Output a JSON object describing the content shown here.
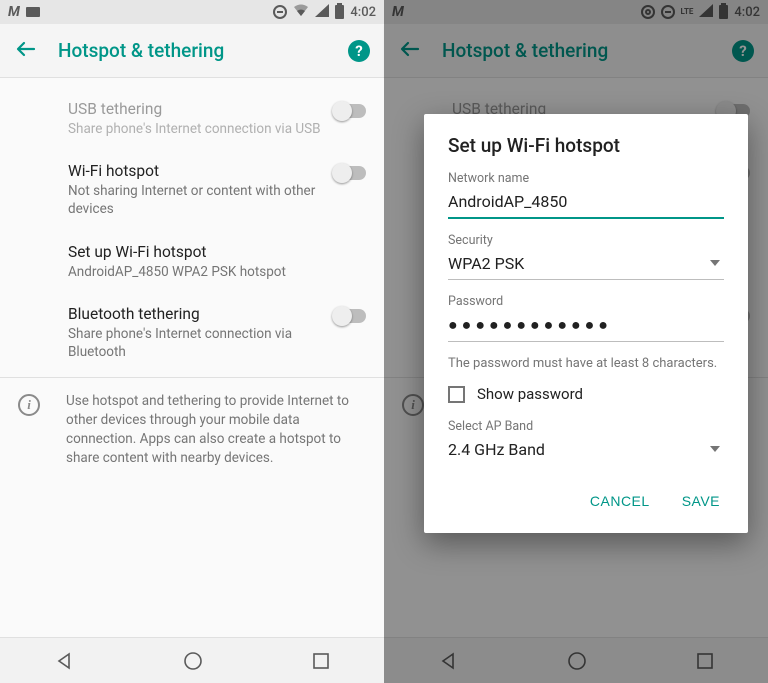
{
  "status": {
    "time": "4:02",
    "lte": "LTE"
  },
  "appbar": {
    "title": "Hotspot & tethering"
  },
  "rows": {
    "usb": {
      "title": "USB tethering",
      "sub": "Share phone's Internet connection via USB"
    },
    "wifi": {
      "title": "Wi-Fi hotspot",
      "sub": "Not sharing Internet or content with other devices"
    },
    "setup": {
      "title": "Set up Wi-Fi hotspot",
      "sub": "AndroidAP_4850 WPA2 PSK hotspot"
    },
    "bt": {
      "title": "Bluetooth tethering",
      "sub": "Share phone's Internet connection via Bluetooth"
    }
  },
  "info": "Use hotspot and tethering to provide Internet to other devices through your mobile data connection. Apps can also create a hotspot to share content with nearby devices.",
  "dialog": {
    "title": "Set up Wi-Fi hotspot",
    "network_label": "Network name",
    "network_value": "AndroidAP_4850",
    "security_label": "Security",
    "security_value": "WPA2 PSK",
    "password_label": "Password",
    "password_value": "●●●●●●●●●●●●",
    "hint": "The password must have at least 8 characters.",
    "show_pw": "Show password",
    "band_label": "Select AP Band",
    "band_value": "2.4 GHz Band",
    "cancel": "CANCEL",
    "save": "SAVE"
  }
}
